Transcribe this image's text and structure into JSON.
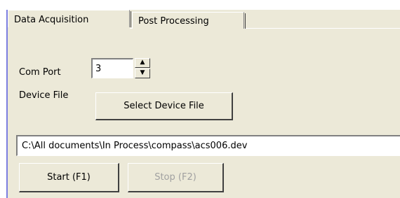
{
  "tabs": [
    {
      "label": "Data Acquisition",
      "active": true
    },
    {
      "label": "Post Processing",
      "active": false
    }
  ],
  "com_port": {
    "label": "Com Port",
    "value": "3",
    "up_arrow": "▲",
    "down_arrow": "▼"
  },
  "device_file": {
    "label": "Device File",
    "button_label": "Select Device File",
    "path": "C:\\All documents\\In Process\\compass\\acs006.dev"
  },
  "actions": {
    "start_label": "Start (F1)",
    "stop_label": "Stop (F2)",
    "stop_enabled": false
  },
  "colors": {
    "panel": "#ece9d8",
    "accent_rule": "#7b7ee0",
    "disabled_text": "#a0a0a0"
  }
}
